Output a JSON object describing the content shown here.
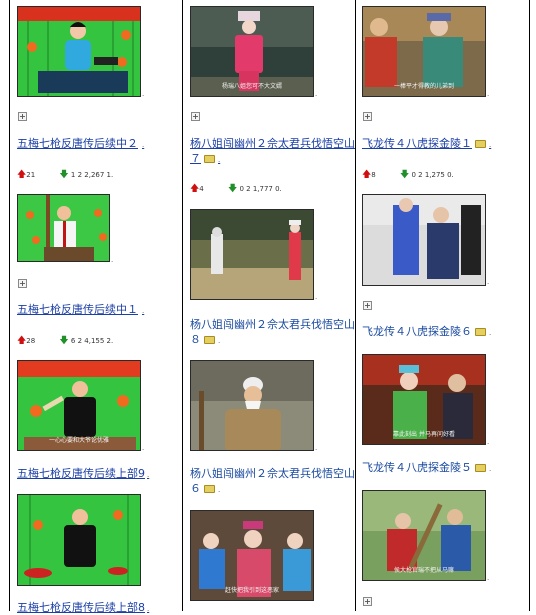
{
  "columns": [
    {
      "items": [
        {
          "title": "五梅七枪反唐传后续中２",
          "stats": {
            "up": "21",
            "down": "1 2 2,267 1."
          }
        },
        {
          "title": "五梅七枪反唐传后续中１",
          "stats": {
            "up": "28",
            "down": "6 2 4,155 2."
          }
        },
        {
          "title": "五梅七枪反唐传后续上部9",
          "caption": "一心心要和大爷论优雅"
        },
        {
          "title": "五梅七枪反唐传后续上部8"
        }
      ]
    },
    {
      "items": [
        {
          "title": "杨八姐闯幽州２佘太君兵伐悟空山７",
          "caption": "杨瑞八姐您可不大文婿",
          "stats": {
            "up": "4",
            "down": "0 2 1,777 0."
          }
        },
        {
          "title": "杨八姐闯幽州２佘太君兵伐悟空山８"
        },
        {
          "title": "杨八姐闯幽州２佘太君兵伐悟空山６"
        },
        {
          "caption": "赶快把我引到这恶家"
        }
      ]
    },
    {
      "items": [
        {
          "title": "飞龙传４八虎探金陵１",
          "caption": "一棒平才得教的儿弟到",
          "stats": {
            "up": "8",
            "down": "0 2 1,275 0."
          }
        },
        {
          "title": "飞龙传４八虎探金陵６"
        },
        {
          "title": "飞龙传４八虎探金陵５",
          "caption": "靠此刻出 并马再问好看"
        },
        {
          "caption": "侯大枪官瑞不把从马嘛"
        }
      ]
    }
  ],
  "marks": {
    "paragraph": "."
  },
  "colors": {
    "link": "#1b3fa6",
    "up_arrow": "#d01010",
    "down_arrow": "#22902a"
  }
}
